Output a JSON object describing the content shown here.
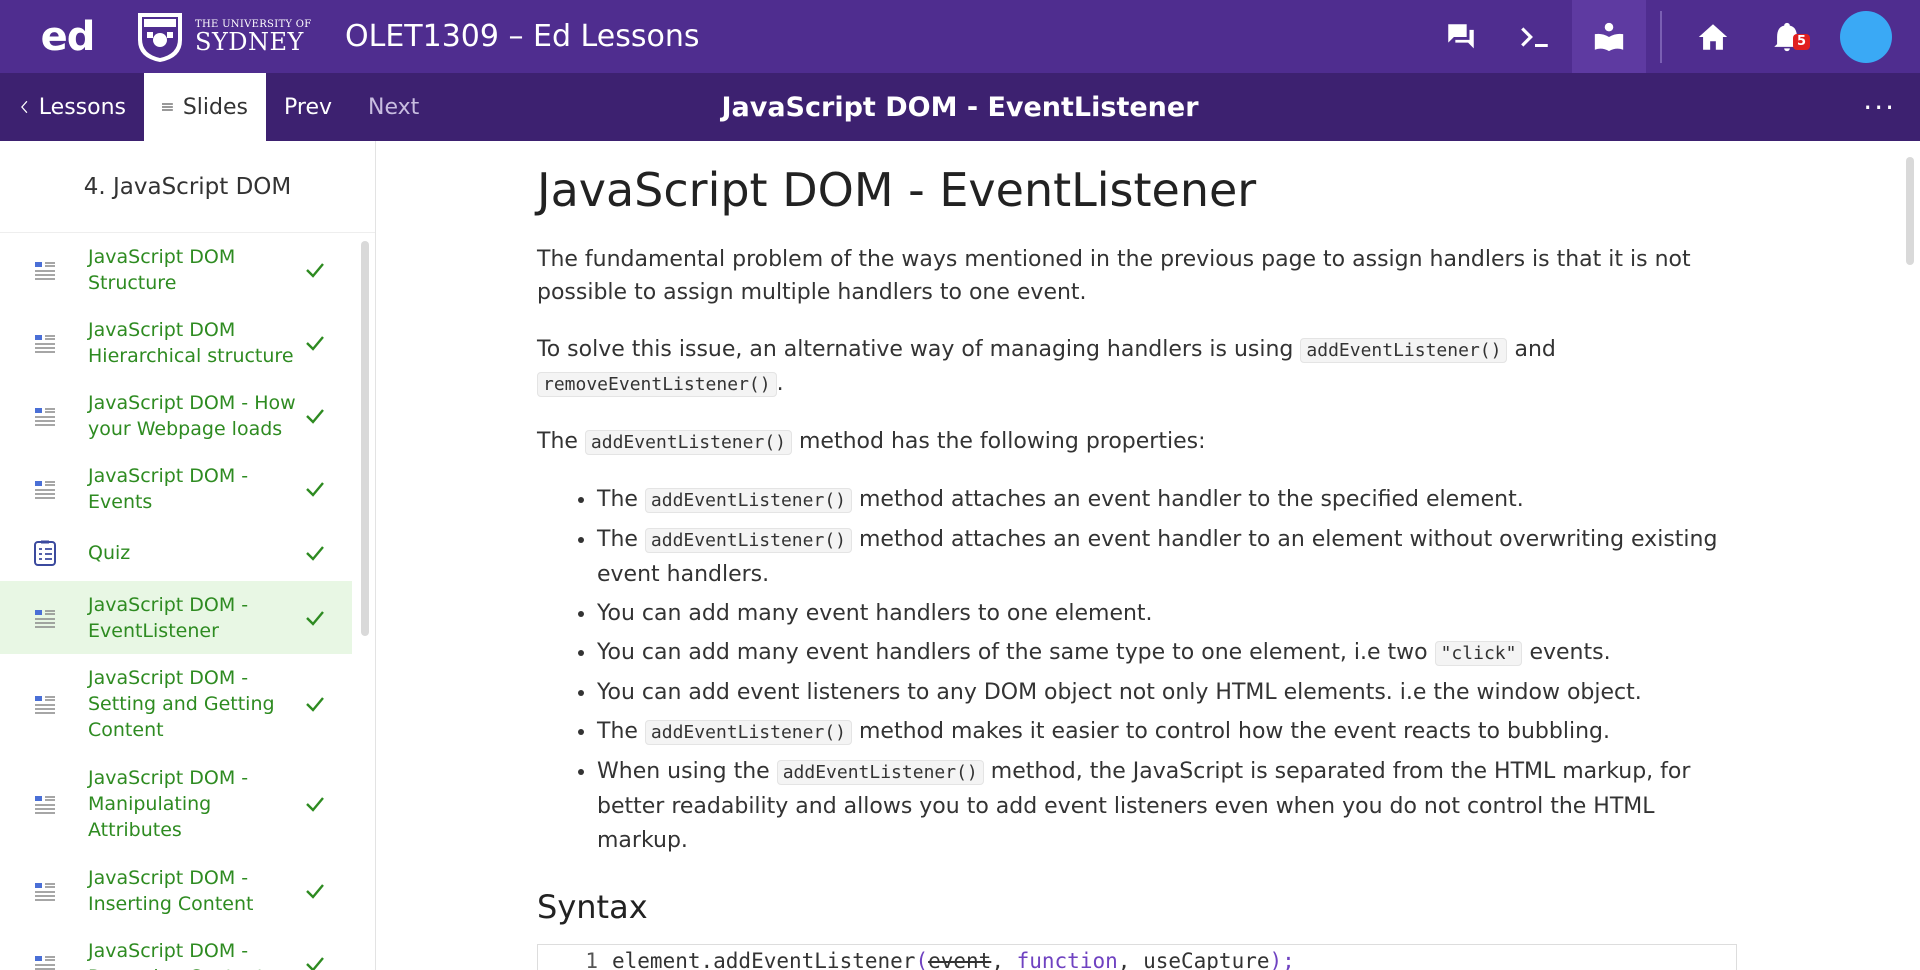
{
  "topbar": {
    "logo": "ed",
    "university_small": "THE UNIVERSITY OF",
    "university_big": "SYDNEY",
    "course_title": "OLET1309 – Ed Lessons",
    "notification_count": "5",
    "icons": [
      "discussion-icon",
      "terminal-icon",
      "lessons-icon",
      "home-icon",
      "bell-icon"
    ]
  },
  "subbar": {
    "lessons": "Lessons",
    "slides": "Slides",
    "prev": "Prev",
    "next": "Next",
    "title": "JavaScript DOM - EventListener",
    "more": "···"
  },
  "sidebar": {
    "header": "4. JavaScript DOM",
    "items": [
      {
        "label": "JavaScript DOM Structure",
        "type": "document",
        "done": true
      },
      {
        "label": "JavaScript DOM Hierarchical structure",
        "type": "document",
        "done": true
      },
      {
        "label": "JavaScript DOM - How your Webpage loads",
        "type": "document",
        "done": true
      },
      {
        "label": "JavaScript DOM - Events",
        "type": "document",
        "done": true
      },
      {
        "label": "Quiz",
        "type": "quiz",
        "done": true
      },
      {
        "label": "JavaScript DOM - EventListener",
        "type": "document",
        "done": true,
        "active": true
      },
      {
        "label": "JavaScript DOM - Setting and Getting Content",
        "type": "document",
        "done": true
      },
      {
        "label": "JavaScript DOM - Manipulating Attributes",
        "type": "document",
        "done": true
      },
      {
        "label": "JavaScript DOM - Inserting Content",
        "type": "document",
        "done": true
      },
      {
        "label": "JavaScript DOM - Removing Content",
        "type": "document",
        "done": true
      }
    ]
  },
  "content": {
    "heading": "JavaScript DOM - EventListener",
    "p1": "The fundamental problem of the ways mentioned in the previous page to assign handlers is that it is not possible to assign multiple handlers to one event.",
    "p2_a": "To solve this issue, an alternative way of managing handlers is using ",
    "p2_code1": "addEventListener()",
    "p2_b": " and ",
    "p2_code2": "removeEventListener()",
    "p2_c": ".",
    "p3_a": "The ",
    "p3_code": "addEventListener()",
    "p3_b": " method has the following properties:",
    "bullets": {
      "b1_a": "The ",
      "b1_code": "addEventListener()",
      "b1_b": " method attaches an event handler to the specified element.",
      "b2_a": "The ",
      "b2_code": "addEventListener()",
      "b2_b": " method attaches an event handler to an element without overwriting existing event handlers.",
      "b3": "You can add many event handlers to one element.",
      "b4_a": "You can add many event handlers of the same type to one element, i.e two ",
      "b4_code": "\"click\"",
      "b4_b": " events.",
      "b5": "You can add event listeners to any DOM object not only HTML elements. i.e the window object.",
      "b6_a": "The ",
      "b6_code": "addEventListener()",
      "b6_b": " method makes it easier to control how the event reacts to bubbling.",
      "b7_a": "When using the ",
      "b7_code": "addEventListener()",
      "b7_b": " method, the JavaScript is separated from the HTML markup, for better readability and allows you to add event listeners even when you do not control the HTML markup."
    },
    "syntax_heading": "Syntax",
    "code": {
      "line_no": "1",
      "fn": "element.addEventListener",
      "open": "(",
      "arg1": "event",
      "comma1": ", ",
      "arg2": "function",
      "comma2": ", ",
      "arg3": "useCapture",
      "close": ");"
    }
  },
  "colors": {
    "topbar": "#4f2d8f",
    "subbar": "#3d2170",
    "completed": "#2e8b21",
    "active_item_bg": "#e8f7e4",
    "avatar": "#3aa9f5"
  }
}
